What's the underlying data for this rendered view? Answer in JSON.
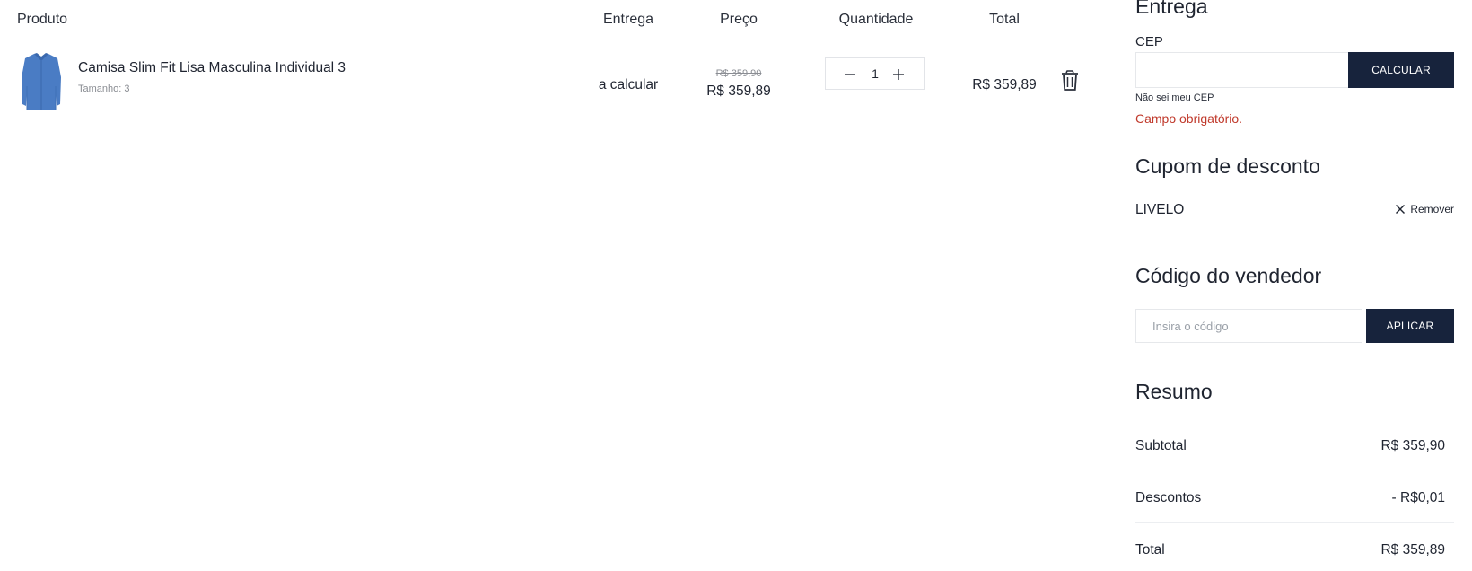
{
  "cart": {
    "headers": {
      "product": "Produto",
      "delivery": "Entrega",
      "price": "Preço",
      "quantity": "Quantidade",
      "total": "Total"
    },
    "items": [
      {
        "name": "Camisa Slim Fit Lisa Masculina Individual 3",
        "size": "Tamanho: 3",
        "delivery": "a calcular",
        "old_price": "R$ 359,90",
        "price": "R$ 359,89",
        "quantity": "1",
        "total": "R$ 359,89",
        "thumbnail_color": "#4a7cc4"
      }
    ]
  },
  "shipping": {
    "title": "Entrega",
    "cep_label": "CEP",
    "cep_value": "",
    "calc_button": "CALCULAR",
    "unknown_cep_link": "Não sei meu CEP",
    "error": "Campo obrigatório."
  },
  "coupon": {
    "title": "Cupom de desconto",
    "code": "LIVELO",
    "remove_label": "Remover"
  },
  "seller": {
    "title": "Código do vendedor",
    "placeholder": "Insira o código",
    "apply_button": "APLICAR"
  },
  "summary": {
    "title": "Resumo",
    "rows": [
      {
        "label": "Subtotal",
        "value": "R$ 359,90"
      },
      {
        "label": "Descontos",
        "value": "- R$0,01"
      },
      {
        "label": "Total",
        "value": "R$ 359,89"
      }
    ]
  },
  "icons": {
    "minus": "minus-icon",
    "plus": "plus-icon",
    "trash": "trash-icon",
    "close": "close-icon"
  },
  "colors": {
    "primary_button": "#17233c",
    "error": "#c0392b",
    "text": "#1f2430",
    "muted": "#8a8d93"
  }
}
